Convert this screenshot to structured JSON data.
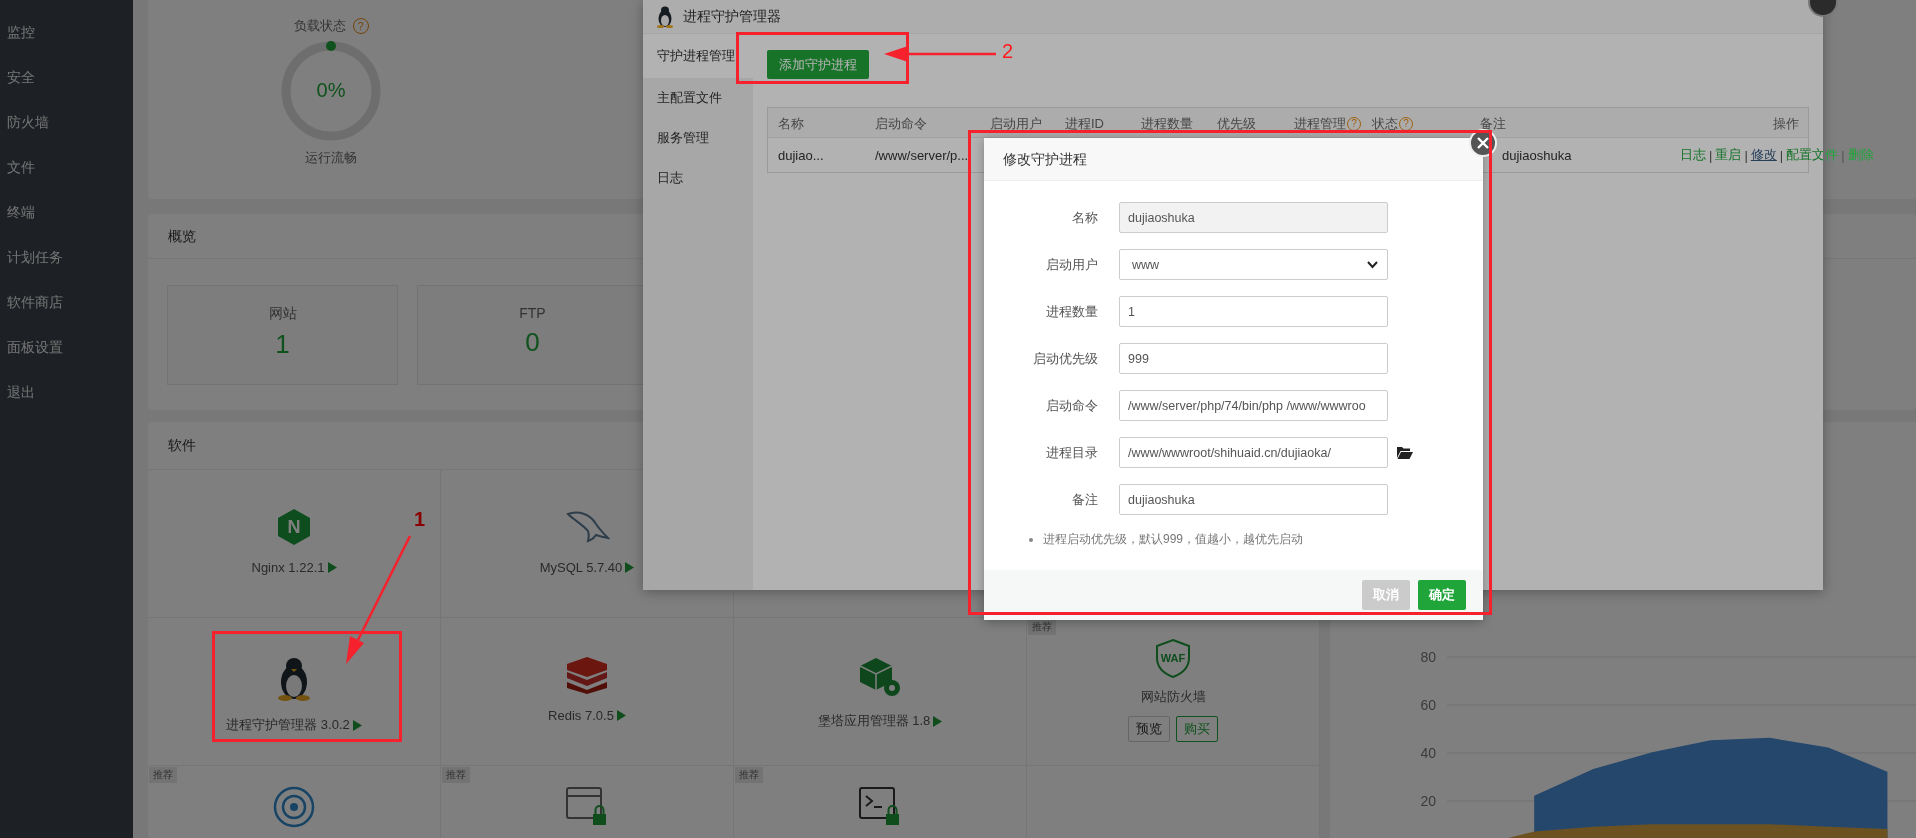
{
  "sidebar": {
    "items": [
      {
        "label": "监控"
      },
      {
        "label": "安全"
      },
      {
        "label": "防火墙"
      },
      {
        "label": "文件"
      },
      {
        "label": "终端"
      },
      {
        "label": "计划任务"
      },
      {
        "label": "软件商店"
      },
      {
        "label": "面板设置"
      },
      {
        "label": "退出"
      }
    ]
  },
  "load_card": {
    "title": "负载状态",
    "help_mark": "?",
    "level": 0,
    "reading": "0%",
    "status": "运行流畅"
  },
  "overview": {
    "title": "概览",
    "stats": [
      {
        "label": "网站",
        "value": "1"
      },
      {
        "label": "FTP",
        "value": "0"
      }
    ]
  },
  "software": {
    "title": "软件",
    "rows": [
      [
        {
          "kind": "app",
          "icon_text": "N",
          "name": "Nginx 1.22.1"
        },
        {
          "kind": "app",
          "name": "MySQL 5.7.40"
        }
      ],
      [
        {
          "kind": "app",
          "name": "进程守护管理器 3.0.2"
        },
        {
          "kind": "app",
          "name": "Redis 7.0.5"
        },
        {
          "kind": "app",
          "name": "堡塔应用管理器 1.8"
        },
        {
          "kind": "promo",
          "tag": "推荐",
          "icon_text": "WAF",
          "name": "网站防火墙",
          "buttons": [
            {
              "label": "预览",
              "kind": "plain"
            },
            {
              "label": "购买",
              "kind": "accent"
            }
          ]
        }
      ],
      [
        {
          "kind": "promo",
          "tag": "推荐"
        },
        {
          "kind": "promo",
          "tag": "推荐"
        },
        {
          "kind": "promo",
          "tag": "推荐"
        }
      ]
    ]
  },
  "chart": {
    "chart_data": {
      "type": "area",
      "ylim": [
        0,
        80
      ],
      "grid": true,
      "yticks": [
        20,
        40,
        60,
        80
      ],
      "series": [
        {
          "color": "#4a8fd8",
          "values": [
            null,
            22,
            33,
            40,
            45,
            46,
            42,
            32
          ]
        },
        {
          "color": "#d9a441",
          "values": [
            1,
            7,
            9,
            10,
            10,
            10,
            9,
            8
          ]
        }
      ]
    }
  },
  "manager_window": {
    "title": "进程守护管理器",
    "nav": [
      {
        "label": "守护进程管理",
        "selected": true
      },
      {
        "label": "主配置文件",
        "selected": false
      },
      {
        "label": "服务管理",
        "selected": false
      },
      {
        "label": "日志",
        "selected": false
      }
    ],
    "add_button": "添加守护进程",
    "table": {
      "columns": [
        {
          "label": "名称"
        },
        {
          "label": "启动命令"
        },
        {
          "label": "启动用户"
        },
        {
          "label": "进程ID"
        },
        {
          "label": "进程数量"
        },
        {
          "label": "优先级"
        },
        {
          "label": "进程管理",
          "help_mark": "?"
        },
        {
          "label": "状态",
          "help_mark": "?"
        },
        {
          "label": "备注"
        },
        {
          "label": "操作"
        }
      ],
      "rows": [
        {
          "separator": "|",
          "name": "dujiao...",
          "command": "/www/server/p...",
          "note": "dujiaoshuka",
          "actions": [
            {
              "label": "日志",
              "hovered": false
            },
            {
              "label": "重启",
              "hovered": false
            },
            {
              "label": "修改",
              "hovered": true
            },
            {
              "label": "配置文件",
              "hovered": false
            },
            {
              "label": "删除",
              "hovered": false
            }
          ]
        }
      ]
    }
  },
  "dialog": {
    "title": "修改守护进程",
    "fields": [
      {
        "label": "名称",
        "kind": "readonly",
        "value": "dujiaoshuka"
      },
      {
        "label": "启动用户",
        "kind": "select",
        "value": "www"
      },
      {
        "label": "进程数量",
        "kind": "text",
        "value": "1"
      },
      {
        "label": "启动优先级",
        "kind": "text",
        "value": "999"
      },
      {
        "label": "启动命令",
        "kind": "text",
        "value": "/www/server/php/74/bin/php /www/wwwroo"
      },
      {
        "label": "进程目录",
        "kind": "path",
        "value": "/www/wwwroot/shihuaid.cn/dujiaoka/"
      },
      {
        "label": "备注",
        "kind": "text",
        "value": "dujiaoshuka"
      }
    ],
    "note": "进程启动优先级，默认999，值越小，越优先启动",
    "buttons": [
      {
        "label": "取消",
        "kind": "cancel"
      },
      {
        "label": "确定",
        "kind": "confirm"
      }
    ]
  },
  "annotations": [
    {
      "label": "1"
    },
    {
      "label": "2"
    }
  ]
}
